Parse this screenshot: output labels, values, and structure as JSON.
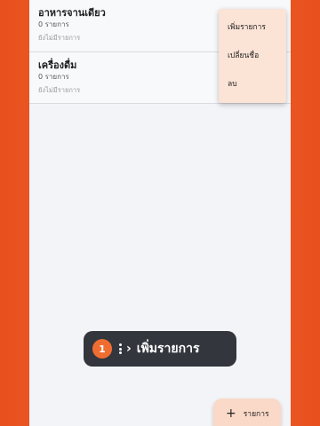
{
  "categories": [
    {
      "title": "อาหารจานเดียว",
      "count": "0 รายการ",
      "empty_text": "ยังไม่มีรายการ"
    },
    {
      "title": "เครื่องดื่ม",
      "count": "0 รายการ",
      "empty_text": "ยังไม่มีรายการ"
    }
  ],
  "context_menu": {
    "items": [
      {
        "label": "เพิ่มรายการ"
      },
      {
        "label": "เปลี่ยนชื่อ"
      },
      {
        "label": "ลบ"
      }
    ]
  },
  "tutorial": {
    "step": "1",
    "icon_sequence": [
      "more-vert-icon",
      "chevron-right-icon"
    ],
    "label": "เพิ่มรายการ"
  },
  "fab": {
    "icon": "plus-icon",
    "label": "รายการ"
  },
  "colors": {
    "background": "#e8501e",
    "accent": "#f06d32",
    "menu_bg": "#fbe3d6",
    "tooltip_bg": "#34363d"
  }
}
